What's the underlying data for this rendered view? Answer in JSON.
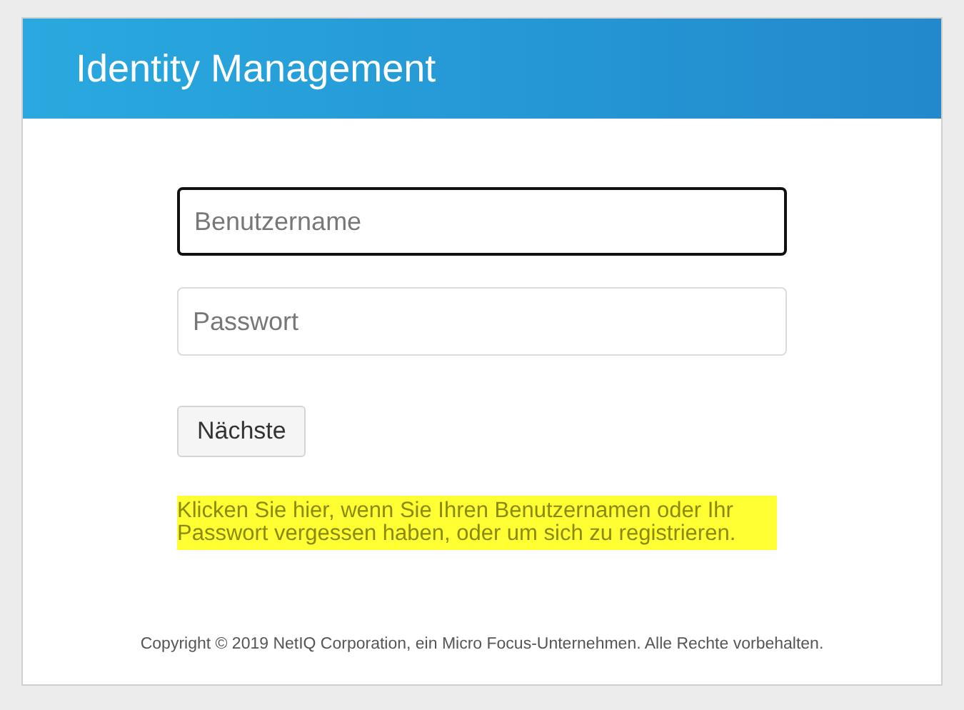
{
  "header": {
    "title": "Identity Management"
  },
  "fields": [
    {
      "placeholder": "Benutzername",
      "focused": true
    },
    {
      "placeholder": "Passwort",
      "focused": false
    }
  ],
  "button": {
    "label": "Nächste"
  },
  "help_link": {
    "text": "Klicken Sie hier, wenn Sie Ihren Benutzernamen oder Ihr Passwort vergessen haben, oder um sich zu registrieren.",
    "highlighted": true
  },
  "footer": {
    "copyright": "Copyright © 2019 NetIQ Corporation, ein Micro Focus-Unternehmen. Alle Rechte vorbehalten."
  }
}
